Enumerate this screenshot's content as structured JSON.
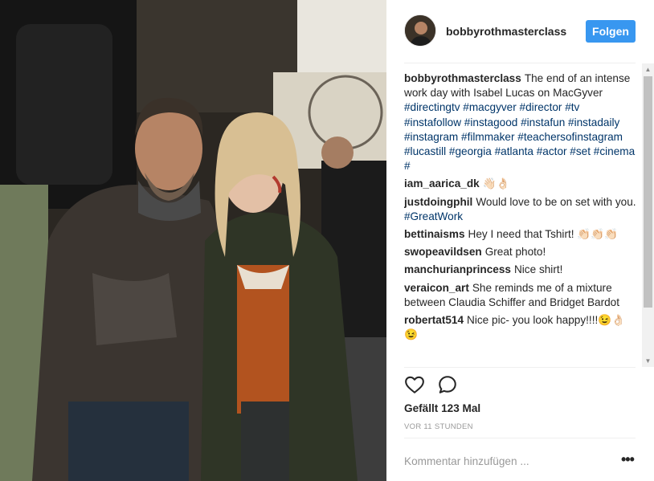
{
  "post": {
    "username": "bobbyrothmasterclass",
    "follow_label": "Folgen",
    "likes": "Gefällt 123 Mal",
    "time": "VOR 11 STUNDEN",
    "comment_placeholder": "Kommentar hinzufügen ...",
    "more_options": "•••",
    "caption": {
      "user": "bobbyrothmasterclass",
      "text": "The end of an intense work day with Isabel Lucas on MacGyver",
      "hashtags": "#directingtv #macgyver #director #tv #instafollow #instagood #instafun #instadaily #instagram #filmmaker #teachersofinstagram #lucastill #georgia #atlanta #actor #set #cinema #"
    }
  },
  "comments": [
    {
      "user": "iam_aarica_dk",
      "text": "👋🏻👌🏻",
      "tag": ""
    },
    {
      "user": "justdoingphil",
      "text": "Would love to be on set with you.",
      "tag": "#GreatWork"
    },
    {
      "user": "bettinaisms",
      "text": "Hey I need that Tshirt! 👏🏻👏🏻👏🏻",
      "tag": ""
    },
    {
      "user": "swopeavildsen",
      "text": "Great photo!",
      "tag": ""
    },
    {
      "user": "manchurianprincess",
      "text": "Nice shirt!",
      "tag": ""
    },
    {
      "user": "veraicon_art",
      "text": "She reminds me of a mixture between Claudia Schiffer and Bridget Bardot",
      "tag": ""
    },
    {
      "user": "robertat514",
      "text": "Nice pic- you look happy!!!!😉👌🏻😉",
      "tag": ""
    }
  ],
  "icons": {
    "like": "heart-icon",
    "comment": "comment-bubble-icon"
  },
  "colors": {
    "accent": "#3897f0",
    "hashtag": "#003569",
    "meta": "#999999"
  }
}
